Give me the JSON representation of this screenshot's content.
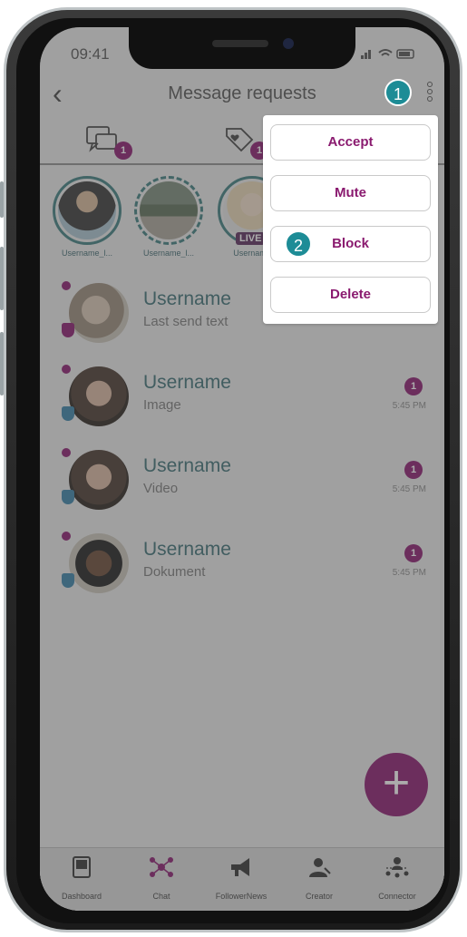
{
  "status_bar": {
    "time": "09:41",
    "icons": "■■ ◠ ▭"
  },
  "header": {
    "title": "Message requests"
  },
  "tabs": [
    {
      "name": "chat-requests",
      "badge": "1"
    },
    {
      "name": "favorites",
      "badge": "1"
    }
  ],
  "stories": [
    {
      "name": "Username_l...",
      "live": ""
    },
    {
      "name": "Username_l...",
      "live": ""
    },
    {
      "name": "Username",
      "live": "LIVE"
    }
  ],
  "chats": [
    {
      "username": "Username",
      "subtext": "Last send text",
      "unread": "",
      "time": ""
    },
    {
      "username": "Username",
      "subtext": "Image",
      "unread": "1",
      "time": "5:45 PM"
    },
    {
      "username": "Username",
      "subtext": "Video",
      "unread": "1",
      "time": "5:45 PM"
    },
    {
      "username": "Username",
      "subtext": "Dokument",
      "unread": "1",
      "time": "5:45 PM"
    }
  ],
  "menu": {
    "accept": "Accept",
    "mute": "Mute",
    "block": "Block",
    "delete": "Delete"
  },
  "markers": {
    "one": "1",
    "two": "2"
  },
  "fab": {
    "label": "+"
  },
  "nav": [
    {
      "label": "Dashboard"
    },
    {
      "label": "Chat"
    },
    {
      "label": "FollowerNews"
    },
    {
      "label": "Creator"
    },
    {
      "label": "Connector"
    }
  ],
  "colors": {
    "accent": "#8a1a6f",
    "teal": "#1d8c96",
    "ring": "#3e7f80"
  }
}
